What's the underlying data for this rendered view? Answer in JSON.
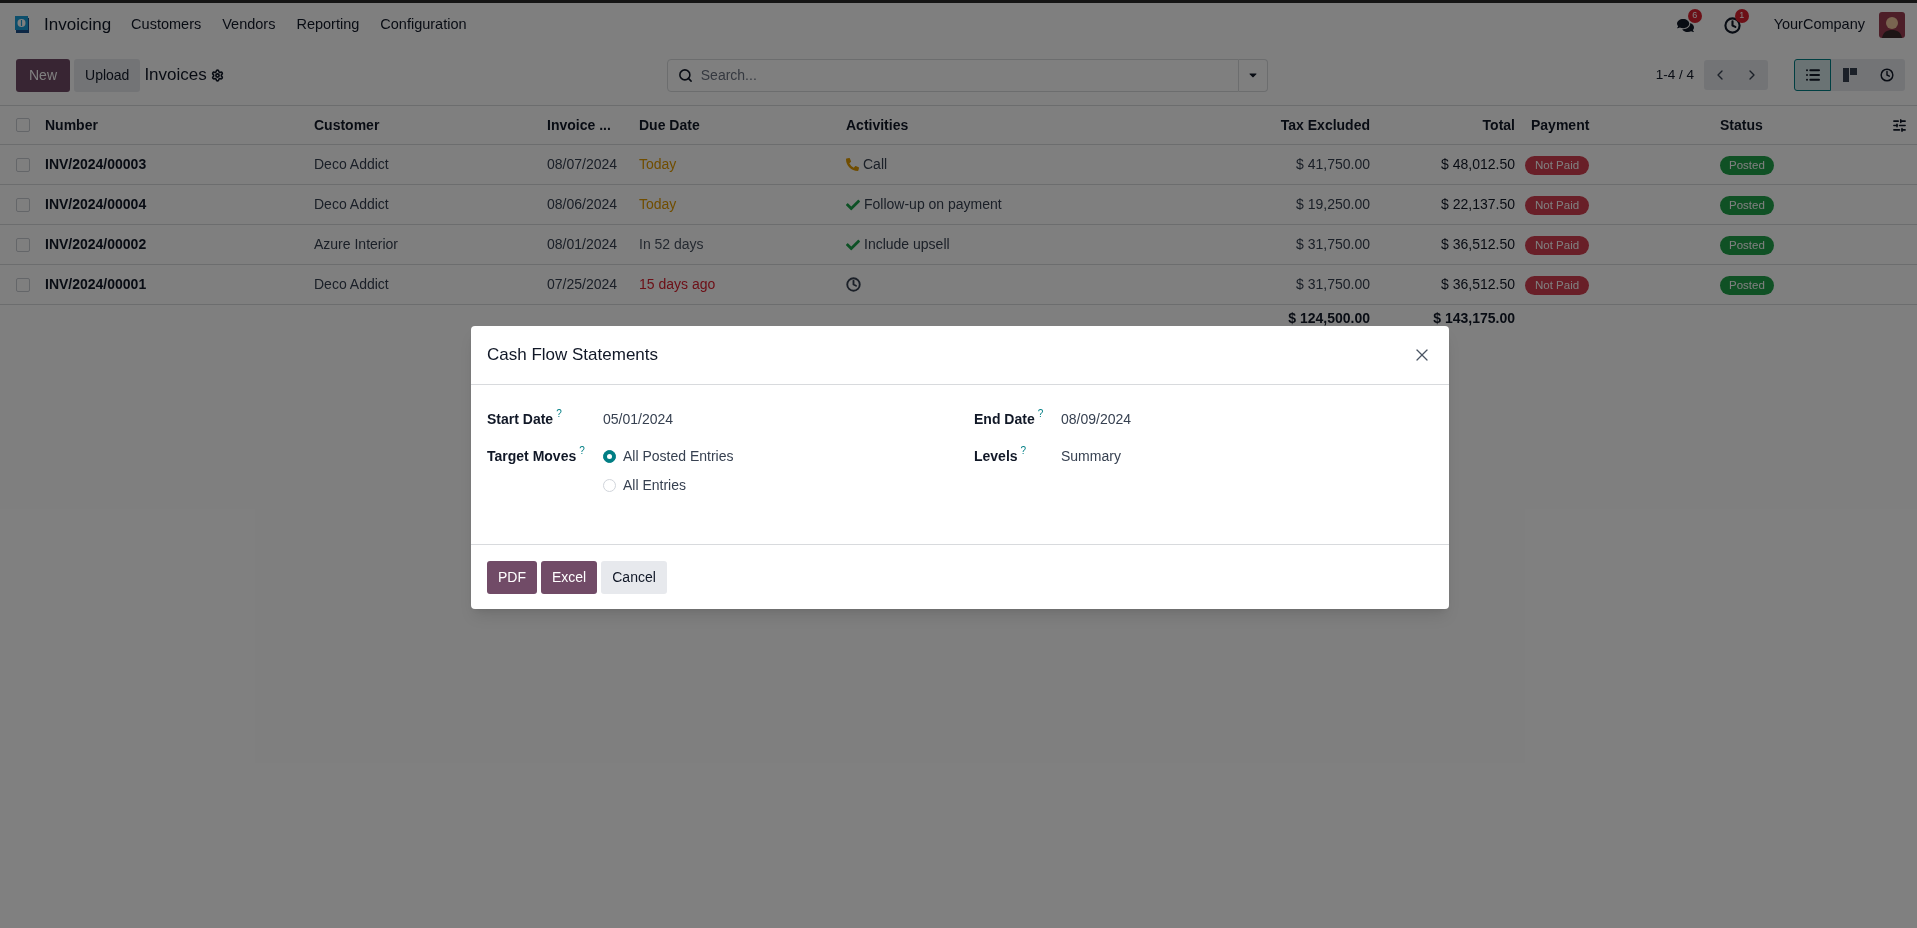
{
  "navbar": {
    "app_name": "Invoicing",
    "menu": [
      "Customers",
      "Vendors",
      "Reporting",
      "Configuration"
    ],
    "messages_count": "6",
    "activities_count": "1",
    "company": "YourCompany"
  },
  "control_panel": {
    "new_button": "New",
    "upload_button": "Upload",
    "title": "Invoices",
    "search": {
      "placeholder": "Search..."
    },
    "pager": "1-4 / 4",
    "views": [
      {
        "kind": "list",
        "selected": true
      },
      {
        "kind": "kanban",
        "selected": false
      },
      {
        "kind": "activity",
        "selected": false
      }
    ]
  },
  "table": {
    "select_all_checked": false,
    "columns": [
      "Number",
      "Customer",
      "Invoice ...",
      "Due Date",
      "Activities",
      "Tax Excluded",
      "Total",
      "Payment",
      "Status"
    ],
    "rows": [
      {
        "checked": false,
        "number": "INV/2024/00003",
        "customer": "Deco Addict",
        "invoice_date": "08/07/2024",
        "due_date": {
          "text": "Today",
          "kind": "today"
        },
        "activity": {
          "kind": "call",
          "text": "Call"
        },
        "tax_excluded": "$ 41,750.00",
        "total": "$ 48,012.50",
        "payment": "Not Paid",
        "status": "Posted"
      },
      {
        "checked": false,
        "number": "INV/2024/00004",
        "customer": "Deco Addict",
        "invoice_date": "08/06/2024",
        "due_date": {
          "text": "Today",
          "kind": "today"
        },
        "activity": {
          "kind": "done",
          "text": "Follow-up on payment"
        },
        "tax_excluded": "$ 19,250.00",
        "total": "$ 22,137.50",
        "payment": "Not Paid",
        "status": "Posted"
      },
      {
        "checked": false,
        "number": "INV/2024/00002",
        "customer": "Azure Interior",
        "invoice_date": "08/01/2024",
        "due_date": {
          "text": "In 52 days",
          "kind": "future"
        },
        "activity": {
          "kind": "done",
          "text": "Include upsell"
        },
        "tax_excluded": "$ 31,750.00",
        "total": "$ 36,512.50",
        "payment": "Not Paid",
        "status": "Posted"
      },
      {
        "checked": false,
        "number": "INV/2024/00001",
        "customer": "Deco Addict",
        "invoice_date": "07/25/2024",
        "due_date": {
          "text": "15 days ago",
          "kind": "overdue"
        },
        "activity": {
          "kind": "clock"
        },
        "tax_excluded": "$ 31,750.00",
        "total": "$ 36,512.50",
        "payment": "Not Paid",
        "status": "Posted"
      }
    ],
    "totals": {
      "tax_excluded": "$ 124,500.00",
      "total": "$ 143,175.00"
    }
  },
  "dialog": {
    "title": "Cash Flow Statements",
    "left_fields": [
      {
        "kind": "text",
        "label": "Start Date",
        "help": "?",
        "value": "05/01/2024"
      },
      {
        "kind": "radio",
        "label": "Target Moves",
        "help": "?",
        "options": [
          {
            "label": "All Posted Entries",
            "selected": true
          },
          {
            "label": "All Entries",
            "selected": false
          }
        ]
      }
    ],
    "right_fields": [
      {
        "kind": "text",
        "label": "End Date",
        "help": "?",
        "value": "08/09/2024"
      },
      {
        "kind": "text",
        "label": "Levels",
        "help": "?",
        "value": "Summary"
      }
    ],
    "buttons": [
      {
        "label": "PDF",
        "kind": "primary"
      },
      {
        "label": "Excel",
        "kind": "primary"
      },
      {
        "label": "Cancel",
        "kind": "secondary"
      }
    ]
  }
}
